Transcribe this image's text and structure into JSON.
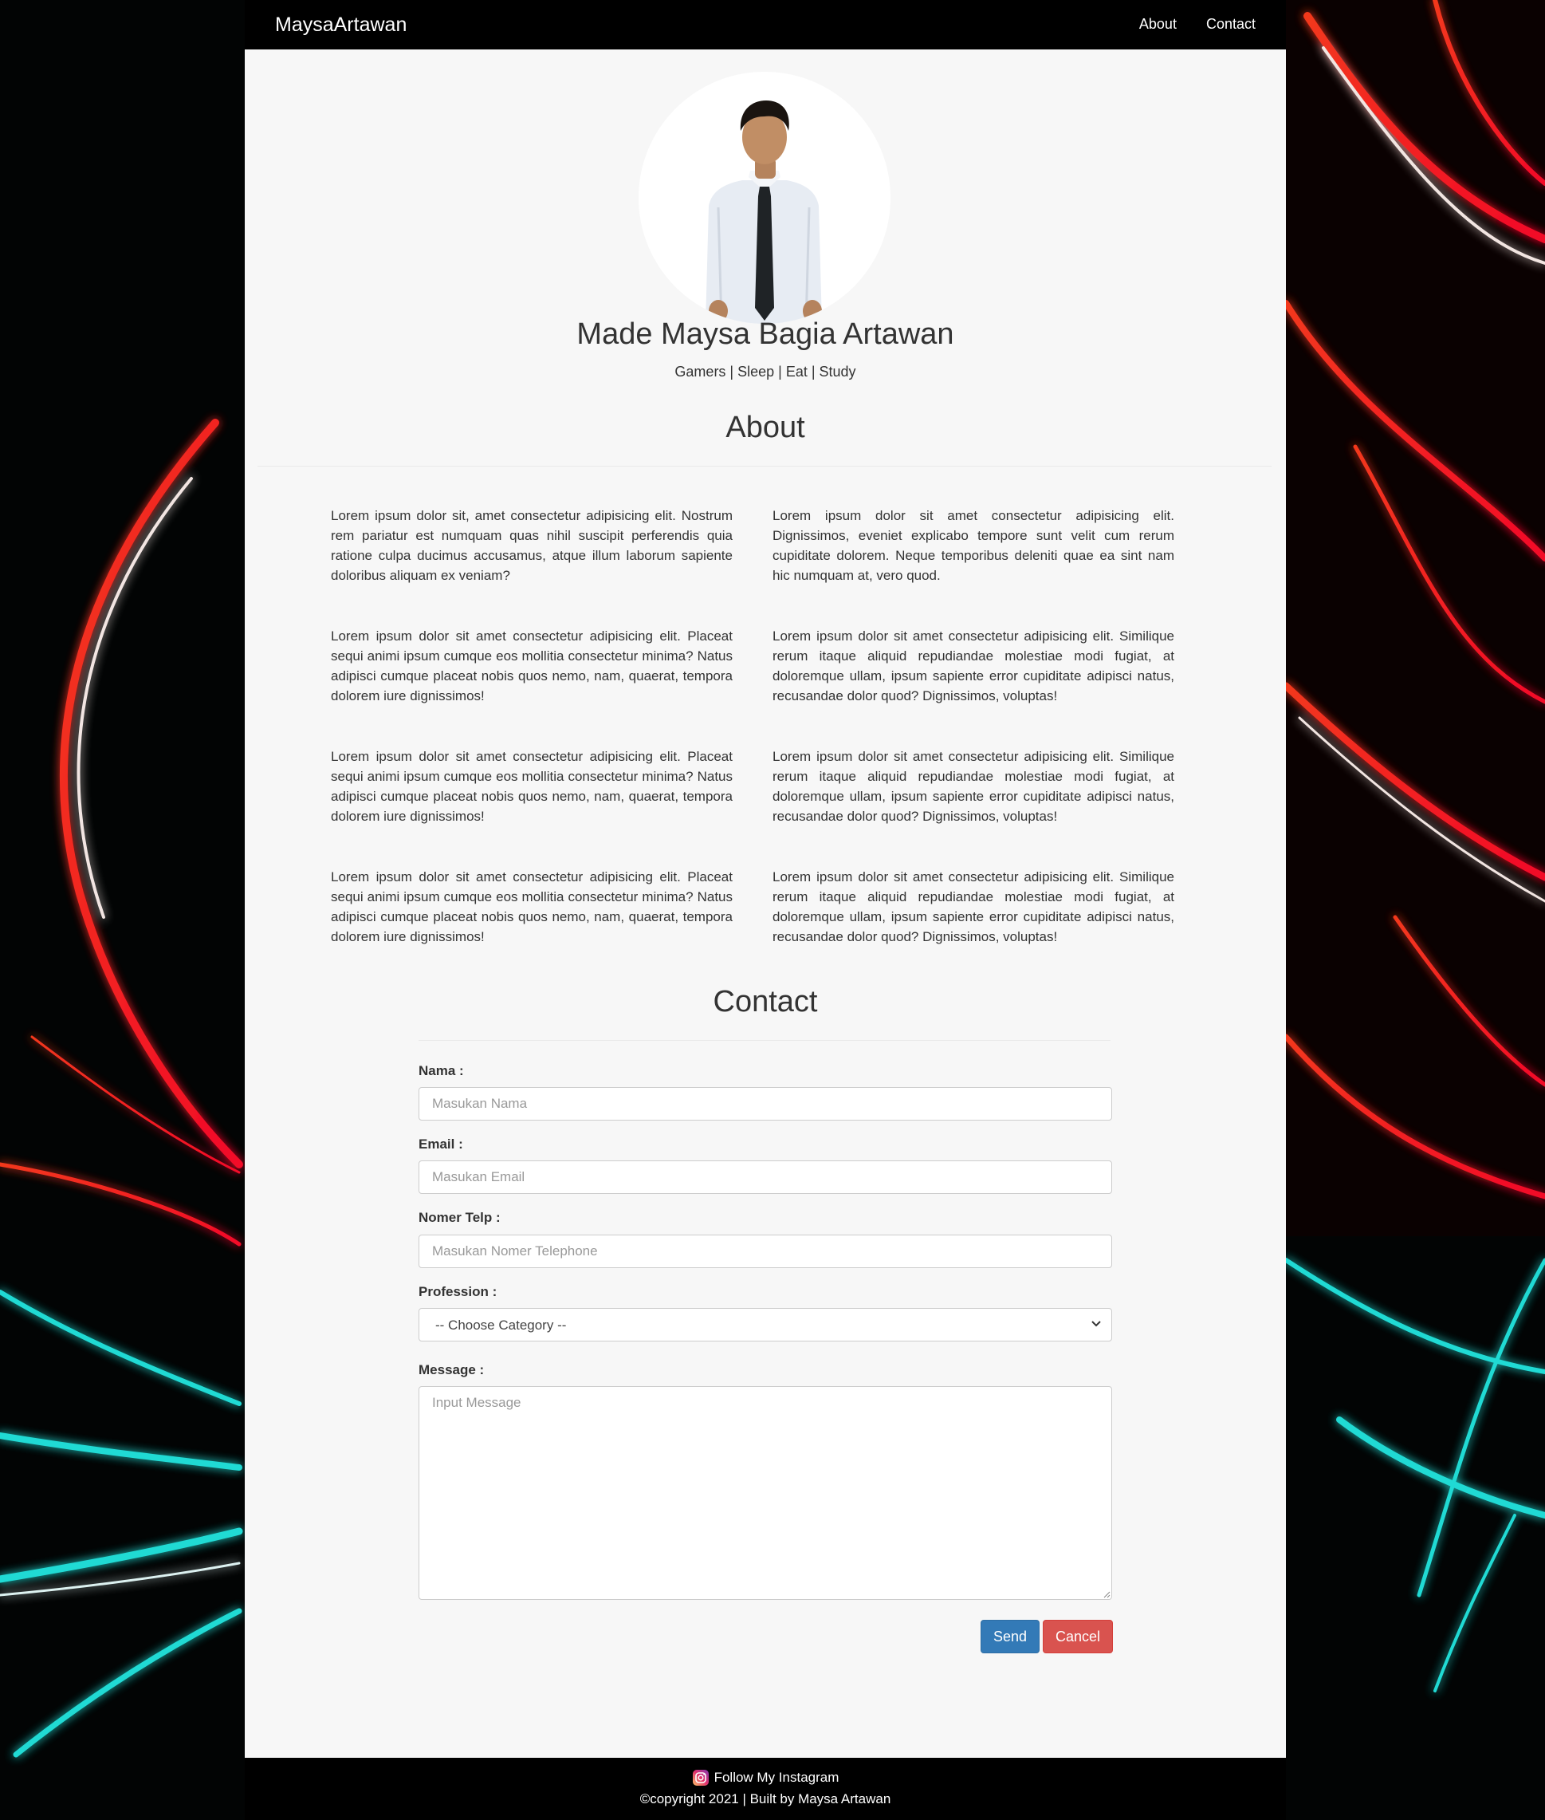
{
  "navbar": {
    "brand": "MaysaArtawan",
    "links": [
      "About",
      "Contact"
    ]
  },
  "profile": {
    "name": "Made Maysa Bagia Artawan",
    "tagline": "Gamers | Sleep | Eat | Study"
  },
  "about": {
    "title": "About",
    "paragraphs_left": [
      "Lorem ipsum dolor sit, amet consectetur adipisicing elit. Nostrum rem pariatur est numquam quas nihil suscipit perferendis quia ratione culpa ducimus accusamus, atque illum laborum sapiente doloribus aliquam ex veniam?",
      "Lorem ipsum dolor sit amet consectetur adipisicing elit. Placeat sequi animi ipsum cumque eos mollitia consectetur minima? Natus adipisci cumque placeat nobis quos nemo, nam, quaerat, tempora dolorem iure dignissimos!",
      "Lorem ipsum dolor sit amet consectetur adipisicing elit. Placeat sequi animi ipsum cumque eos mollitia consectetur minima? Natus adipisci cumque placeat nobis quos nemo, nam, quaerat, tempora dolorem iure dignissimos!",
      "Lorem ipsum dolor sit amet consectetur adipisicing elit. Placeat sequi animi ipsum cumque eos mollitia consectetur minima? Natus adipisci cumque placeat nobis quos nemo, nam, quaerat, tempora dolorem iure dignissimos!"
    ],
    "paragraphs_right": [
      "Lorem ipsum dolor sit amet consectetur adipisicing elit. Dignissimos, eveniet explicabo tempore sunt velit cum rerum cupiditate dolorem. Neque temporibus deleniti quae ea sint nam hic numquam at, vero quod.",
      "Lorem ipsum dolor sit amet consectetur adipisicing elit. Similique rerum itaque aliquid repudiandae molestiae modi fugiat, at doloremque ullam, ipsum sapiente error cupiditate adipisci natus, recusandae dolor quod? Dignissimos, voluptas!",
      "Lorem ipsum dolor sit amet consectetur adipisicing elit. Similique rerum itaque aliquid repudiandae molestiae modi fugiat, at doloremque ullam, ipsum sapiente error cupiditate adipisci natus, recusandae dolor quod? Dignissimos, voluptas!",
      "Lorem ipsum dolor sit amet consectetur adipisicing elit. Similique rerum itaque aliquid repudiandae molestiae modi fugiat, at doloremque ullam, ipsum sapiente error cupiditate adipisci natus, recusandae dolor quod? Dignissimos, voluptas!"
    ]
  },
  "contact": {
    "title": "Contact",
    "nama_label": "Nama :",
    "nama_placeholder": "Masukan Nama",
    "email_label": "Email :",
    "email_placeholder": "Masukan Email",
    "telp_label": "Nomer Telp :",
    "telp_placeholder": "Masukan Nomer Telephone",
    "profession_label": "Profession :",
    "profession_selected": "-- Choose Category --",
    "message_label": "Message :",
    "message_placeholder": "Input Message",
    "send_label": "Send",
    "cancel_label": "Cancel"
  },
  "footer": {
    "instagram_text": "Follow My Instagram",
    "copyright": "©copyright 2021 | Built by Maysa Artawan"
  },
  "colors": {
    "navbar_bg": "#000000",
    "panel_bg": "#f7f7f7",
    "send_button": "#337ab7",
    "cancel_button": "#d9534f"
  },
  "icons": {
    "select_arrow": "chevron-down-icon",
    "footer_icon": "instagram-icon"
  }
}
